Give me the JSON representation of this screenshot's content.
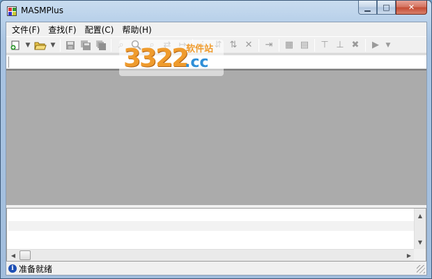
{
  "window": {
    "title": "MASMPlus",
    "caption": {
      "minimize": "▁",
      "maximize": "□",
      "close": "✕"
    }
  },
  "menu": {
    "items": [
      {
        "id": "file",
        "label": "文件(F)"
      },
      {
        "id": "find",
        "label": "查找(F)"
      },
      {
        "id": "config",
        "label": "配置(C)"
      },
      {
        "id": "help",
        "label": "帮助(H)"
      }
    ]
  },
  "toolbar": {
    "new_icon": "new-file-icon",
    "open_icon": "open-folder-icon",
    "save_icon": "save-icon",
    "save_as_icon": "save-as-icon",
    "save_all_icon": "save-all-icon",
    "search_icon": "magnifier-icon",
    "build_icon": "build-icon",
    "run_icon": "run-icon"
  },
  "statusbar": {
    "text": "准备就绪"
  },
  "watermark": {
    "number": "3322",
    "site_cn": "软件站",
    "domain": ".cc"
  },
  "colors": {
    "mdi_background": "#ababab",
    "info_icon": "#1e4fb4",
    "close_button": "#c44a32"
  }
}
